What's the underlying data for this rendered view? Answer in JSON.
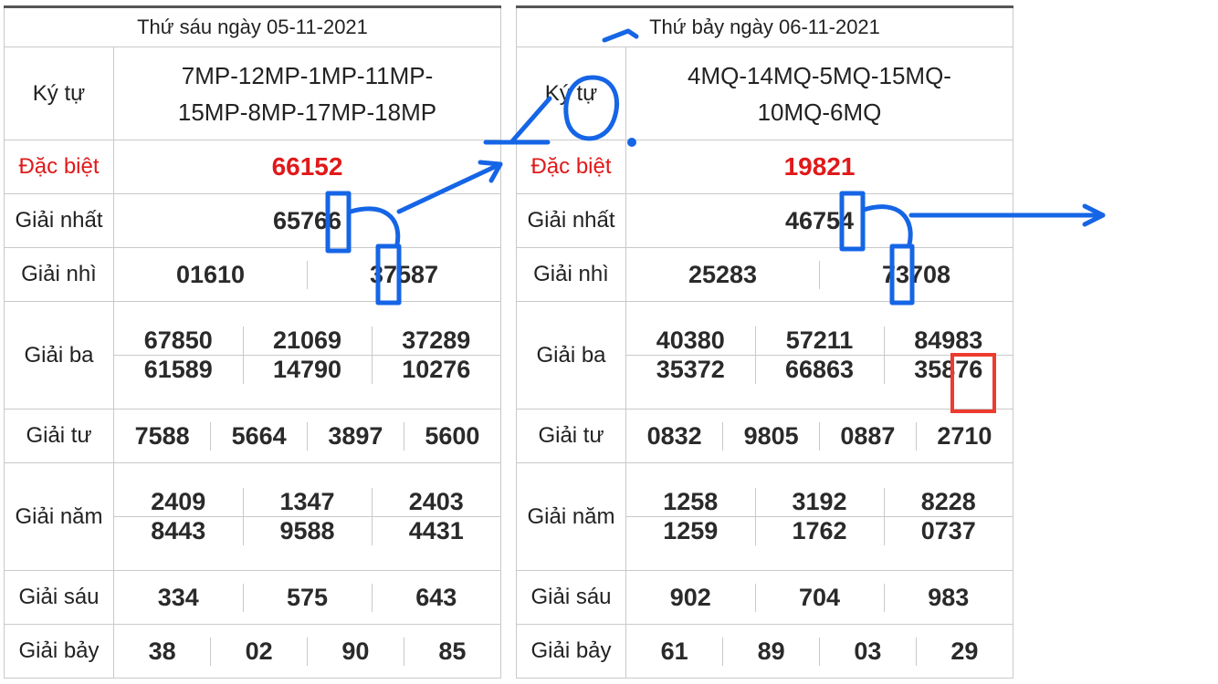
{
  "left": {
    "date": "Thứ sáu ngày 05-11-2021",
    "ky_tu_label": "Ký tự",
    "ky_tu_line1": "7MP-12MP-1MP-11MP-",
    "ky_tu_line2": "15MP-8MP-17MP-18MP",
    "dac_biet_label": "Đặc biệt",
    "dac_biet": "66152",
    "nhat_label": "Giải nhất",
    "nhat": "65766",
    "nhi_label": "Giải nhì",
    "nhi": [
      "01610",
      "37587"
    ],
    "ba_label": "Giải ba",
    "ba": [
      "67850",
      "21069",
      "37289",
      "61589",
      "14790",
      "10276"
    ],
    "tu_label": "Giải tư",
    "tu": [
      "7588",
      "5664",
      "3897",
      "5600"
    ],
    "nam_label": "Giải năm",
    "nam": [
      "2409",
      "1347",
      "2403",
      "8443",
      "9588",
      "4431"
    ],
    "sau_label": "Giải sáu",
    "sau": [
      "334",
      "575",
      "643"
    ],
    "bay_label": "Giải bảy",
    "bay": [
      "38",
      "02",
      "90",
      "85"
    ]
  },
  "right": {
    "date": "Thứ bảy ngày 06-11-2021",
    "ky_tu_label": "Ký tự",
    "ky_tu_line1": "4MQ-14MQ-5MQ-15MQ-",
    "ky_tu_line2": "10MQ-6MQ",
    "dac_biet_label": "Đặc biệt",
    "dac_biet": "19821",
    "nhat_label": "Giải nhất",
    "nhat": "46754",
    "nhi_label": "Giải nhì",
    "nhi": [
      "25283",
      "73708"
    ],
    "ba_label": "Giải ba",
    "ba": [
      "40380",
      "57211",
      "84983",
      "35372",
      "66863",
      "35876"
    ],
    "tu_label": "Giải tư",
    "tu": [
      "0832",
      "9805",
      "0887",
      "2710"
    ],
    "nam_label": "Giải năm",
    "nam": [
      "1258",
      "3192",
      "8228",
      "1259",
      "1762",
      "0737"
    ],
    "sau_label": "Giải sáu",
    "sau": [
      "902",
      "704",
      "983"
    ],
    "bay_label": "Giải bảy",
    "bay": [
      "61",
      "89",
      "03",
      "29"
    ]
  },
  "annotation": {
    "handwritten_text": "LÔ",
    "colors": {
      "blue": "#1565e6",
      "red": "#ee3b2f"
    }
  }
}
